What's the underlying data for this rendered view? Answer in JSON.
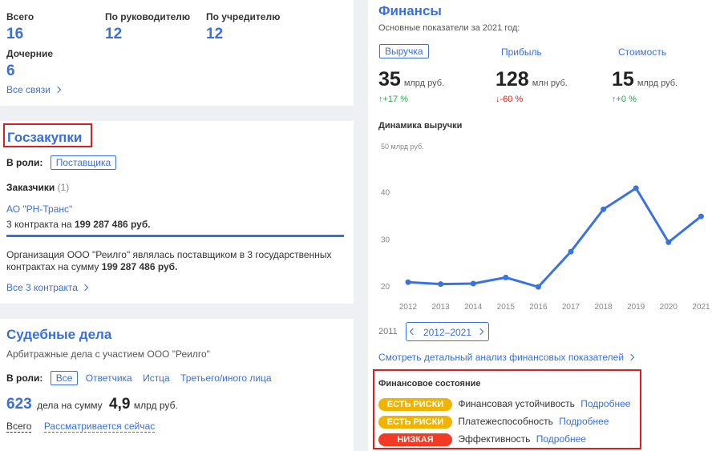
{
  "stats": {
    "total_label": "Всего",
    "total_value": "16",
    "by_head_label": "По руководителю",
    "by_head_value": "12",
    "by_founder_label": "По учредителю",
    "by_founder_value": "12",
    "subsidiary_label": "Дочерние",
    "subsidiary_value": "6",
    "all_links": "Все связи"
  },
  "gos": {
    "title": "Госзакупки",
    "role_label": "В роли:",
    "role_value": "Поставщика",
    "customers_label": "Заказчики",
    "customers_count": "(1)",
    "customer_name": "АО \"РН-Транс\"",
    "contracts_prefix": "3 контракта на",
    "contracts_sum": "199 287 486 руб.",
    "desc_line1": "Организация ООО \"Реилго\" являлась поставщиком в 3 государственных",
    "desc_line2_prefix": "контрактах на сумму",
    "desc_line2_sum": "199 287 486 руб.",
    "all_contracts": "Все 3 контракта"
  },
  "sud": {
    "title": "Судебные дела",
    "subtitle": "Арбитражные дела с участием ООО \"Реилго\"",
    "role_label": "В роли:",
    "roles": [
      "Все",
      "Ответчика",
      "Истца",
      "Третьего/иного лица"
    ],
    "count": "623",
    "count_suffix": "дела на сумму",
    "sum": "4,9",
    "sum_unit": "млрд руб.",
    "tab_all": "Всего",
    "tab_now": "Рассматривается сейчас"
  },
  "fin": {
    "title": "Финансы",
    "subtitle": "Основные показатели за 2021 год:",
    "tabs": [
      "Выручка",
      "Прибыль",
      "Стоимость"
    ],
    "metrics": [
      {
        "value": "35",
        "unit": "млрд руб.",
        "change": "↑+17 %",
        "dir": "up"
      },
      {
        "value": "128",
        "unit": "млн руб.",
        "change": "↓-60 %",
        "dir": "down"
      },
      {
        "value": "15",
        "unit": "млрд руб.",
        "change": "↑+0 %",
        "dir": "up"
      }
    ],
    "chart_title": "Динамика выручки",
    "range_start": "2011",
    "range_label": "2012–2021",
    "detail_link": "Смотреть детальный анализ финансовых показателей",
    "state_title": "Финансовое состояние",
    "states": [
      {
        "badge": "ЕСТЬ РИСКИ",
        "color": "yellow",
        "label": "Финансовая устойчивость",
        "more": "Подробнее"
      },
      {
        "badge": "ЕСТЬ РИСКИ",
        "color": "yellow",
        "label": "Платежеспособность",
        "more": "Подробнее"
      },
      {
        "badge": "НИЗКАЯ",
        "color": "red",
        "label": "Эффективность",
        "more": "Подробнее"
      }
    ]
  },
  "chart_data": {
    "type": "line",
    "title": "Динамика выручки",
    "x": [
      "2012",
      "2013",
      "2014",
      "2015",
      "2016",
      "2017",
      "2018",
      "2019",
      "2020",
      "2021"
    ],
    "series": [
      {
        "values": [
          21,
          20.6,
          20.7,
          22,
          20,
          27.5,
          36.5,
          41,
          29.5,
          35
        ]
      }
    ],
    "y_ticks": [
      20,
      30,
      40
    ],
    "y_top_label": "50 млрд руб.",
    "ylim": [
      19,
      50
    ],
    "grid": false,
    "color": "#3a73e0"
  }
}
